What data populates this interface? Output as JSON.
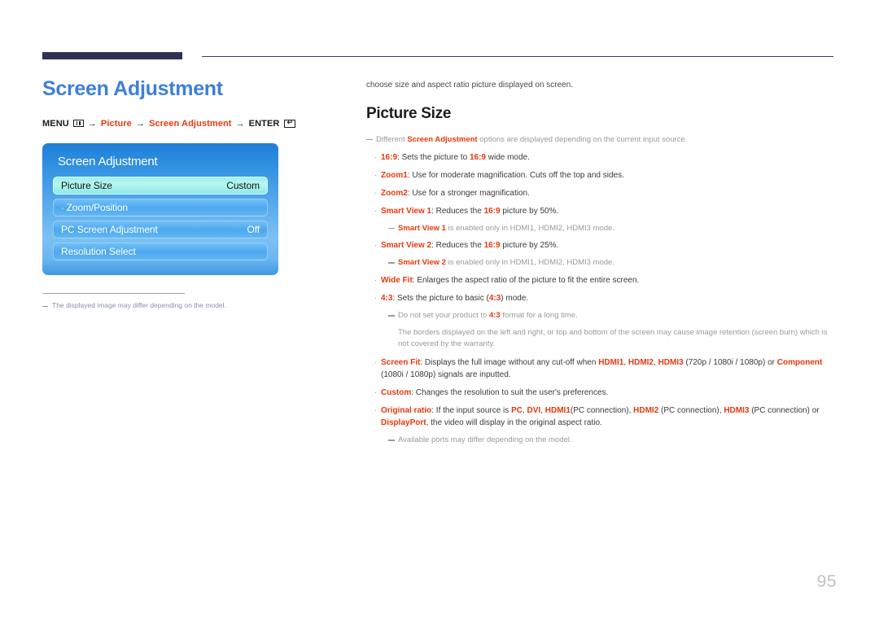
{
  "colors": {
    "accent_red": "#e8380d",
    "title_blue": "#3d7fdb",
    "rule_navy": "#2e3355",
    "page_number_gray": "#c2c2c2"
  },
  "left": {
    "page_title": "Screen Adjustment",
    "breadcrumb": {
      "menu_label": "MENU",
      "menu_icon": "menu-grid-icon",
      "arrow": "→",
      "item1": "Picture",
      "item2": "Screen Adjustment",
      "enter_label": "ENTER",
      "enter_icon": "enter-return-icon",
      "enter_glyph": "↵"
    },
    "osd": {
      "title": "Screen Adjustment",
      "rows": [
        {
          "label": "Picture Size",
          "value": "Custom",
          "selected": true,
          "prefix": ""
        },
        {
          "label": "Zoom/Position",
          "value": "",
          "selected": false,
          "prefix": "·"
        },
        {
          "label": "PC Screen Adjustment",
          "value": "Off",
          "selected": false,
          "prefix": ""
        },
        {
          "label": "Resolution Select",
          "value": "",
          "selected": false,
          "prefix": ""
        }
      ]
    },
    "footnote": "The displayed image may differ depending on the model."
  },
  "right": {
    "intro": "choose size and aspect ratio picture displayed on screen.",
    "section_title": "Picture Size",
    "note_top": {
      "pre": "Different ",
      "term": "Screen Adjustment",
      "post": " options are displayed depending on the current input source."
    },
    "bullet_mark": "·",
    "items": [
      {
        "term": "16:9",
        "body_pre": ": Sets the picture to ",
        "emph": "16:9",
        "body_post": " wide mode."
      },
      {
        "term": "Zoom1",
        "body_pre": ": Use for moderate magnification. Cuts off the top and sides.",
        "emph": "",
        "body_post": ""
      },
      {
        "term": "Zoom2",
        "body_pre": ": Use for a stronger magnification.",
        "emph": "",
        "body_post": ""
      },
      {
        "term": "Smart View 1",
        "body_pre": ": Reduces the ",
        "emph": "16:9",
        "body_post": " picture by 50%.",
        "note": {
          "term": "Smart View 1",
          "mid": " is enabled only in ",
          "ports": [
            "HDMI1",
            "HDMI2",
            "HDMI3"
          ],
          "tail": " mode."
        }
      },
      {
        "term": "Smart View 2",
        "body_pre": ": Reduces the ",
        "emph": "16:9",
        "body_post": " picture by 25%.",
        "note": {
          "term": "Smart View 2",
          "mid": " is enabled only in ",
          "ports": [
            "HDMI1",
            "HDMI2",
            "HDMI3"
          ],
          "tail": " mode."
        }
      },
      {
        "term": "Wide Fit",
        "body_pre": ": Enlarges the aspect ratio of the picture to fit the entire screen.",
        "emph": "",
        "body_post": ""
      },
      {
        "term": "4:3",
        "body_pre": ": Sets the picture to basic (",
        "emph": "4:3",
        "body_post": ") mode."
      }
    ],
    "note_43": {
      "pre": "Do not set your product to ",
      "term": "4:3",
      "post": " format for a long time."
    },
    "note_43_cont": "The borders displayed on the left and right, or top and bottom of the screen may cause image retention (screen burn) which is not covered by the warranty.",
    "screen_fit": {
      "term": "Screen Fit",
      "pre": ": Displays the full image without any cut-off when ",
      "ports": [
        "HDMI1",
        "HDMI2",
        "HDMI3"
      ],
      "mid": " (720p / 1080i / 1080p) or ",
      "term2": "Component",
      "tail": " (1080i / 1080p) signals are inputted."
    },
    "custom": {
      "term": "Custom",
      "body": ": Changes the resolution to suit the user's preferences."
    },
    "original_ratio": {
      "term": "Original ratio",
      "pre": ": If the input source is ",
      "src1": "PC",
      "src2": "DVI",
      "src3": "HDMI1",
      "src3_tail": "(PC connection), ",
      "src4": "HDMI2",
      "src4_tail": " (PC connection), ",
      "src5": "HDMI3",
      "src5_tail": " (PC connection)",
      "line2_pre": "or ",
      "src6": "DisplayPort",
      "line2_tail": ", the video will display in the original aspect ratio."
    },
    "note_ports": "Available ports may differ depending on the model."
  },
  "page_number": "95"
}
